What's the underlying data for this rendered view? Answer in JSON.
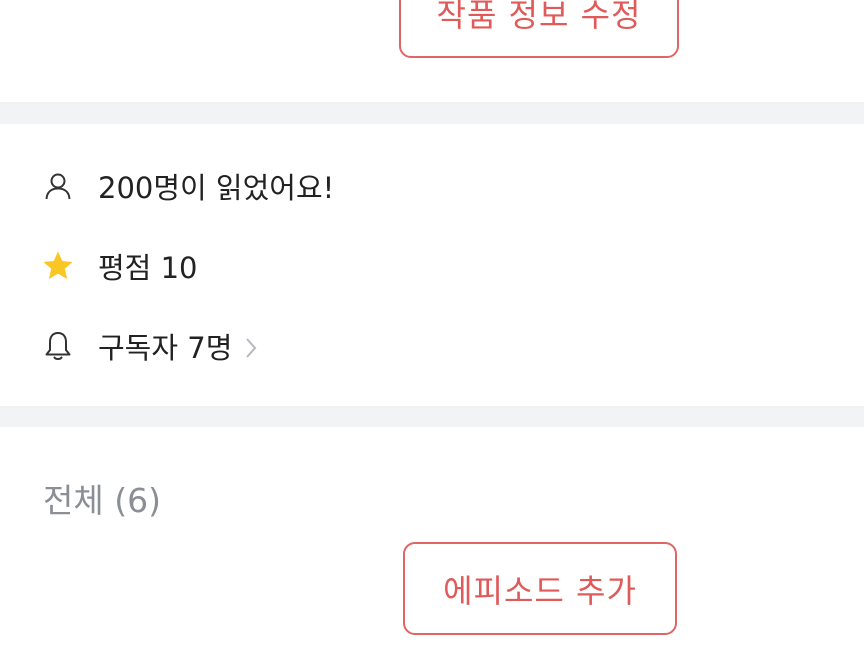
{
  "header": {
    "edit_button_label": "작품 정보 수정"
  },
  "stats": {
    "readers": "200명이 읽었어요!",
    "rating": "평점 10",
    "subscribers": "구독자 7명"
  },
  "episodes": {
    "title": "전체 (6)",
    "add_button_label": "에피소드 추가"
  },
  "icons": {
    "readers": "person-icon",
    "rating": "star-icon",
    "subscribers": "bell-icon",
    "subscribers_more": "chevron-right-icon"
  },
  "colors": {
    "accent": "#e05a5a",
    "star": "#f9c623",
    "divider": "#f2f3f5",
    "muted_text": "#8a8f96"
  }
}
